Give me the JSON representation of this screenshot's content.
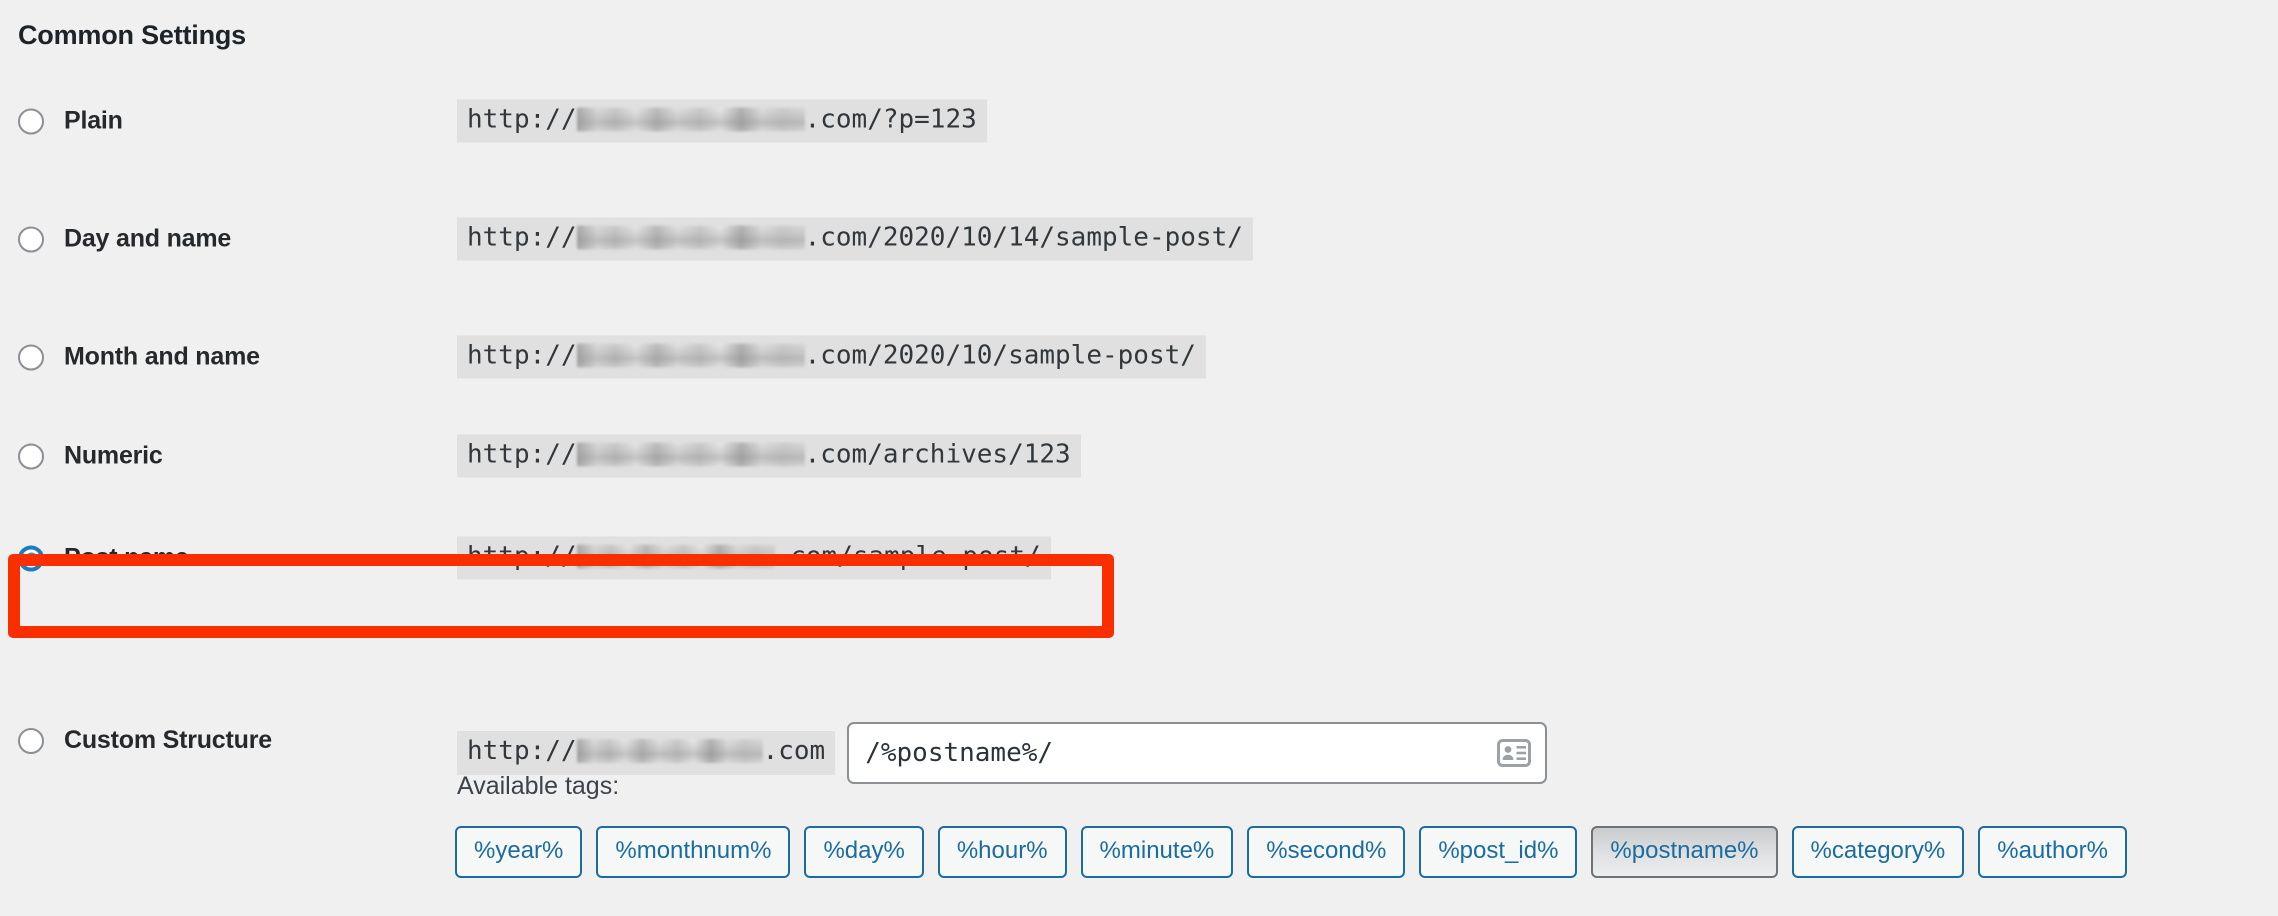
{
  "page": {
    "title": "Common Settings"
  },
  "colors": {
    "highlight_border": "#fa2f00",
    "radio_selected": "#2b96d6",
    "tag_link": "#1b6ca0",
    "background": "#f0f0f1"
  },
  "options": [
    {
      "key": "plain",
      "label": "Plain",
      "selected": false,
      "url_prefix": "http://",
      "url_redacted": true,
      "url_suffix": ".com/?p=123",
      "redacted_width": 228
    },
    {
      "key": "day-and-name",
      "label": "Day and name",
      "selected": false,
      "url_prefix": "http://",
      "url_redacted": true,
      "url_suffix": ".com/2020/10/14/sample-post/",
      "redacted_width": 228
    },
    {
      "key": "month-and-name",
      "label": "Month and name",
      "selected": false,
      "url_prefix": "http://",
      "url_redacted": true,
      "url_suffix": ".com/2020/10/sample-post/",
      "redacted_width": 228
    },
    {
      "key": "numeric",
      "label": "Numeric",
      "selected": false,
      "url_prefix": "http://",
      "url_redacted": true,
      "url_suffix": ".com/archives/123",
      "redacted_width": 228
    },
    {
      "key": "post-name",
      "label": "Post name",
      "selected": true,
      "url_prefix": "http://",
      "url_redacted": true,
      "url_suffix": ".com/sample-post/",
      "redacted_width": 198
    }
  ],
  "custom_structure": {
    "label": "Custom Structure",
    "selected": false,
    "url_prefix": "http://",
    "url_suffix": ".com",
    "redacted_width": 186,
    "input_value": "/%postname%/",
    "input_icon": "contact-card-autofill-icon"
  },
  "available_tags": {
    "label": "Available tags:",
    "tags": [
      {
        "label": "%year%",
        "active": false
      },
      {
        "label": "%monthnum%",
        "active": false
      },
      {
        "label": "%day%",
        "active": false
      },
      {
        "label": "%hour%",
        "active": false
      },
      {
        "label": "%minute%",
        "active": false
      },
      {
        "label": "%second%",
        "active": false
      },
      {
        "label": "%post_id%",
        "active": false
      },
      {
        "label": "%postname%",
        "active": true
      },
      {
        "label": "%category%",
        "active": false
      },
      {
        "label": "%author%",
        "active": false
      }
    ]
  }
}
